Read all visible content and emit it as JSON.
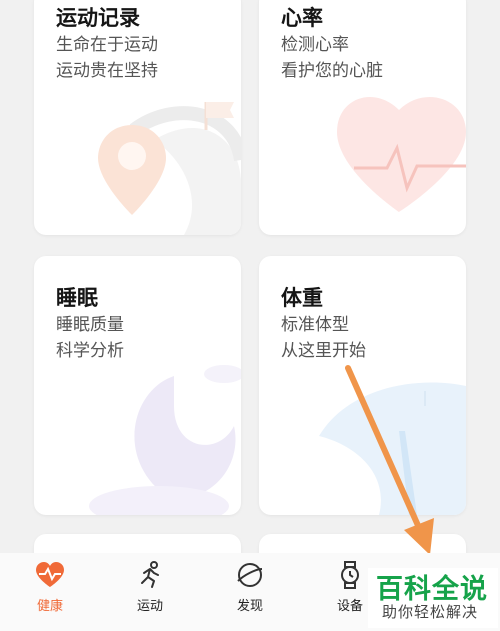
{
  "cards": [
    {
      "title": "运动记录",
      "sub1": "生命在于运动",
      "sub2": "运动贵在坚持"
    },
    {
      "title": "心率",
      "sub1": "检测心率",
      "sub2": "看护您的心脏"
    },
    {
      "title": "睡眠",
      "sub1": "睡眠质量",
      "sub2": "科学分析"
    },
    {
      "title": "体重",
      "sub1": "标准体型",
      "sub2": "从这里开始"
    }
  ],
  "tabs": [
    {
      "label": "健康",
      "icon": "heart-pulse-icon",
      "active": true
    },
    {
      "label": "运动",
      "icon": "running-icon",
      "active": false
    },
    {
      "label": "发现",
      "icon": "planet-icon",
      "active": false
    },
    {
      "label": "设备",
      "icon": "watch-icon",
      "active": false
    }
  ],
  "watermark": {
    "main": "百科全说",
    "sub": "助你轻松解决"
  },
  "colors": {
    "accent": "#f06a38",
    "arrow": "#f0954a",
    "watermark": "#16a34a"
  }
}
